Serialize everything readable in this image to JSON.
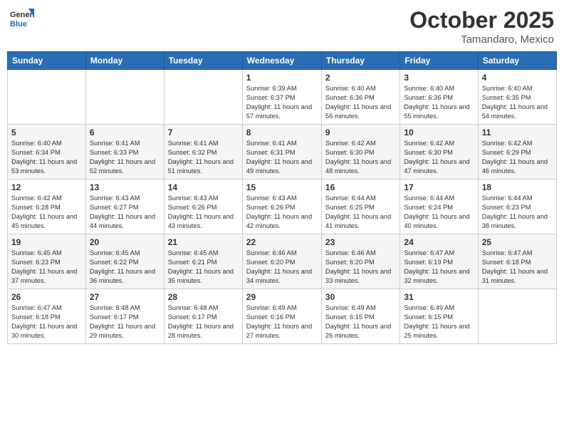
{
  "header": {
    "logo_general": "General",
    "logo_blue": "Blue",
    "month_year": "October 2025",
    "location": "Tamandaro, Mexico"
  },
  "weekdays": [
    "Sunday",
    "Monday",
    "Tuesday",
    "Wednesday",
    "Thursday",
    "Friday",
    "Saturday"
  ],
  "weeks": [
    [
      {
        "day": "",
        "info": ""
      },
      {
        "day": "",
        "info": ""
      },
      {
        "day": "",
        "info": ""
      },
      {
        "day": "1",
        "info": "Sunrise: 6:39 AM\nSunset: 6:37 PM\nDaylight: 11 hours and 57 minutes."
      },
      {
        "day": "2",
        "info": "Sunrise: 6:40 AM\nSunset: 6:36 PM\nDaylight: 11 hours and 56 minutes."
      },
      {
        "day": "3",
        "info": "Sunrise: 6:40 AM\nSunset: 6:36 PM\nDaylight: 11 hours and 55 minutes."
      },
      {
        "day": "4",
        "info": "Sunrise: 6:40 AM\nSunset: 6:35 PM\nDaylight: 11 hours and 54 minutes."
      }
    ],
    [
      {
        "day": "5",
        "info": "Sunrise: 6:40 AM\nSunset: 6:34 PM\nDaylight: 11 hours and 53 minutes."
      },
      {
        "day": "6",
        "info": "Sunrise: 6:41 AM\nSunset: 6:33 PM\nDaylight: 11 hours and 52 minutes."
      },
      {
        "day": "7",
        "info": "Sunrise: 6:41 AM\nSunset: 6:32 PM\nDaylight: 11 hours and 51 minutes."
      },
      {
        "day": "8",
        "info": "Sunrise: 6:41 AM\nSunset: 6:31 PM\nDaylight: 11 hours and 49 minutes."
      },
      {
        "day": "9",
        "info": "Sunrise: 6:42 AM\nSunset: 6:30 PM\nDaylight: 11 hours and 48 minutes."
      },
      {
        "day": "10",
        "info": "Sunrise: 6:42 AM\nSunset: 6:30 PM\nDaylight: 11 hours and 47 minutes."
      },
      {
        "day": "11",
        "info": "Sunrise: 6:42 AM\nSunset: 6:29 PM\nDaylight: 11 hours and 46 minutes."
      }
    ],
    [
      {
        "day": "12",
        "info": "Sunrise: 6:42 AM\nSunset: 6:28 PM\nDaylight: 11 hours and 45 minutes."
      },
      {
        "day": "13",
        "info": "Sunrise: 6:43 AM\nSunset: 6:27 PM\nDaylight: 11 hours and 44 minutes."
      },
      {
        "day": "14",
        "info": "Sunrise: 6:43 AM\nSunset: 6:26 PM\nDaylight: 11 hours and 43 minutes."
      },
      {
        "day": "15",
        "info": "Sunrise: 6:43 AM\nSunset: 6:26 PM\nDaylight: 11 hours and 42 minutes."
      },
      {
        "day": "16",
        "info": "Sunrise: 6:44 AM\nSunset: 6:25 PM\nDaylight: 11 hours and 41 minutes."
      },
      {
        "day": "17",
        "info": "Sunrise: 6:44 AM\nSunset: 6:24 PM\nDaylight: 11 hours and 40 minutes."
      },
      {
        "day": "18",
        "info": "Sunrise: 6:44 AM\nSunset: 6:23 PM\nDaylight: 11 hours and 38 minutes."
      }
    ],
    [
      {
        "day": "19",
        "info": "Sunrise: 6:45 AM\nSunset: 6:23 PM\nDaylight: 11 hours and 37 minutes."
      },
      {
        "day": "20",
        "info": "Sunrise: 6:45 AM\nSunset: 6:22 PM\nDaylight: 11 hours and 36 minutes."
      },
      {
        "day": "21",
        "info": "Sunrise: 6:45 AM\nSunset: 6:21 PM\nDaylight: 11 hours and 35 minutes."
      },
      {
        "day": "22",
        "info": "Sunrise: 6:46 AM\nSunset: 6:20 PM\nDaylight: 11 hours and 34 minutes."
      },
      {
        "day": "23",
        "info": "Sunrise: 6:46 AM\nSunset: 6:20 PM\nDaylight: 11 hours and 33 minutes."
      },
      {
        "day": "24",
        "info": "Sunrise: 6:47 AM\nSunset: 6:19 PM\nDaylight: 11 hours and 32 minutes."
      },
      {
        "day": "25",
        "info": "Sunrise: 6:47 AM\nSunset: 6:18 PM\nDaylight: 11 hours and 31 minutes."
      }
    ],
    [
      {
        "day": "26",
        "info": "Sunrise: 6:47 AM\nSunset: 6:18 PM\nDaylight: 11 hours and 30 minutes."
      },
      {
        "day": "27",
        "info": "Sunrise: 6:48 AM\nSunset: 6:17 PM\nDaylight: 11 hours and 29 minutes."
      },
      {
        "day": "28",
        "info": "Sunrise: 6:48 AM\nSunset: 6:17 PM\nDaylight: 11 hours and 28 minutes."
      },
      {
        "day": "29",
        "info": "Sunrise: 6:49 AM\nSunset: 6:16 PM\nDaylight: 11 hours and 27 minutes."
      },
      {
        "day": "30",
        "info": "Sunrise: 6:49 AM\nSunset: 6:15 PM\nDaylight: 11 hours and 26 minutes."
      },
      {
        "day": "31",
        "info": "Sunrise: 6:49 AM\nSunset: 6:15 PM\nDaylight: 11 hours and 25 minutes."
      },
      {
        "day": "",
        "info": ""
      }
    ]
  ]
}
